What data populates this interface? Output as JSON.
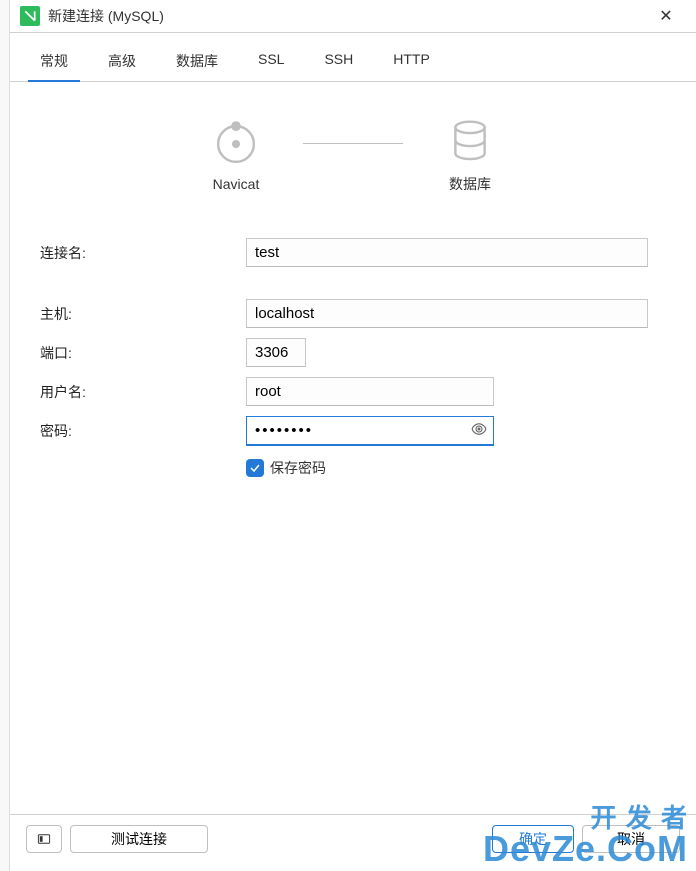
{
  "window": {
    "title": "新建连接 (MySQL)"
  },
  "tabs": {
    "general": "常规",
    "advanced": "高级",
    "database": "数据库",
    "ssl": "SSL",
    "ssh": "SSH",
    "http": "HTTP"
  },
  "diagram": {
    "client": "Navicat",
    "server": "数据库"
  },
  "form": {
    "name_label": "连接名:",
    "name_value": "test",
    "host_label": "主机:",
    "host_value": "localhost",
    "port_label": "端口:",
    "port_value": "3306",
    "user_label": "用户名:",
    "user_value": "root",
    "password_label": "密码:",
    "password_value": "••••••••",
    "save_password_label": "保存密码"
  },
  "footer": {
    "test_connection": "测试连接",
    "ok": "确定",
    "cancel": "取消"
  },
  "watermark": {
    "line1": "开 发 者",
    "line2": "DevZe.CoM"
  }
}
